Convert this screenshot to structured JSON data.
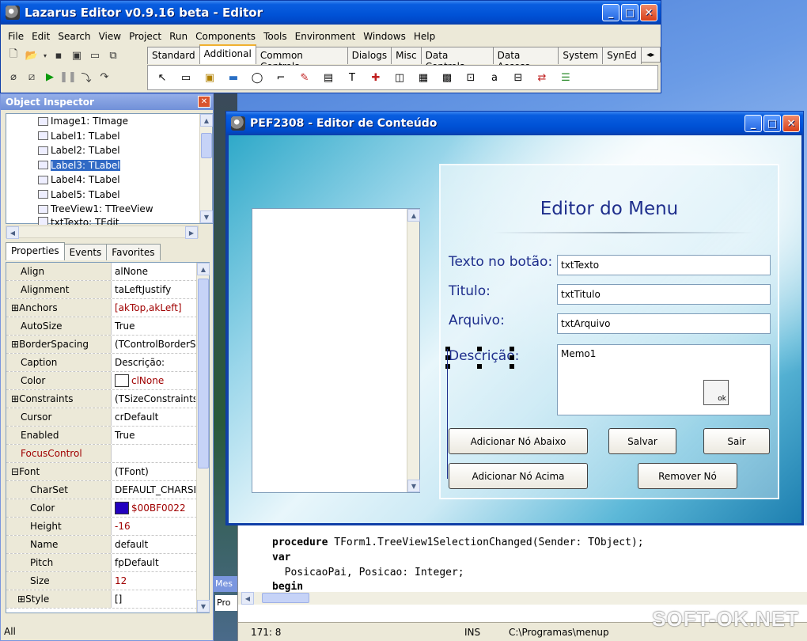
{
  "main": {
    "title": "Lazarus Editor v0.9.16 beta - Editor",
    "menu": [
      "File",
      "Edit",
      "Search",
      "View",
      "Project",
      "Run",
      "Components",
      "Tools",
      "Environment",
      "Windows",
      "Help"
    ],
    "palette_tabs": [
      "Standard",
      "Additional",
      "Common Controls",
      "Dialogs",
      "Misc",
      "Data Controls",
      "Data Access",
      "System",
      "SynEd"
    ],
    "active_palette_tab": "Additional"
  },
  "inspector": {
    "title": "Object Inspector",
    "tree": [
      "Image1: TImage",
      "Label1: TLabel",
      "Label2: TLabel",
      "Label3: TLabel",
      "Label4: TLabel",
      "Label5: TLabel",
      "TreeView1: TTreeView",
      "txtTexto: TEdit"
    ],
    "selected_tree_item": "Label3: TLabel",
    "tabs": [
      "Properties",
      "Events",
      "Favorites"
    ],
    "properties": [
      {
        "name": "Align",
        "value": "alNone"
      },
      {
        "name": "Alignment",
        "value": "taLeftJustify"
      },
      {
        "name": "Anchors",
        "value": "[akTop,akLeft]",
        "expander": "⊞",
        "value_color": "red"
      },
      {
        "name": "AutoSize",
        "value": "True"
      },
      {
        "name": "BorderSpacing",
        "value": "(TControlBorderSp",
        "expander": "⊞"
      },
      {
        "name": "Caption",
        "value": "Descrição:"
      },
      {
        "name": "Color",
        "value": "clNone",
        "swatch": "#ffffff",
        "value_color": "red"
      },
      {
        "name": "Constraints",
        "value": "(TSizeConstraints)",
        "expander": "⊞"
      },
      {
        "name": "Cursor",
        "value": "crDefault"
      },
      {
        "name": "Enabled",
        "value": "True"
      },
      {
        "name": "FocusControl",
        "value": "",
        "name_color": "red"
      },
      {
        "name": "Font",
        "value": "(TFont)",
        "expander": "⊟"
      },
      {
        "name": "CharSet",
        "value": "DEFAULT_CHARSE",
        "sub": true
      },
      {
        "name": "Color",
        "value": "$00BF0022",
        "swatch": "#2200bf",
        "value_color": "red",
        "sub": true
      },
      {
        "name": "Height",
        "value": "-16",
        "value_color": "red",
        "sub": true
      },
      {
        "name": "Name",
        "value": "default",
        "sub": true
      },
      {
        "name": "Pitch",
        "value": "fpDefault",
        "sub": true
      },
      {
        "name": "Size",
        "value": "12",
        "value_color": "red",
        "sub": true
      },
      {
        "name": "Style",
        "value": "[]",
        "expander": "⊞",
        "sub": true
      }
    ],
    "status": "All"
  },
  "form": {
    "title": "PEF2308 - Editor de Conteúdo",
    "panel_title": "Editor do Menu",
    "labels": {
      "texto": "Texto no botão:",
      "titulo": "Titulo:",
      "arquivo": "Arquivo:",
      "descricao": "Descrição:"
    },
    "edits": {
      "texto": "txtTexto",
      "titulo": "txtTitulo",
      "arquivo": "txtArquivo",
      "memo": "Memo1"
    },
    "buttons": {
      "add_below": "Adicionar Nó Abaixo",
      "save": "Salvar",
      "exit": "Sair",
      "add_above": "Adicionar Nó Acima",
      "remove": "Remover Nó"
    }
  },
  "editor": {
    "code_line1_kw": "procedure",
    "code_line1_rest": " TForm1.TreeView1SelectionChanged(Sender: TObject);",
    "code_line2": "var",
    "code_line3": "  PosicaoPai, Posicao: Integer;",
    "code_line4": "begin",
    "status_pos": "171:  8",
    "status_mode": "INS",
    "status_file": "C:\\Programas\\menup",
    "side_labels": [
      "Mes",
      "Pro"
    ]
  },
  "watermark": "SOFT-OK.NET",
  "colors": {
    "xp_blue": "#0052d6",
    "selection": "#316ac5",
    "label_text": "#1e2e8c"
  }
}
